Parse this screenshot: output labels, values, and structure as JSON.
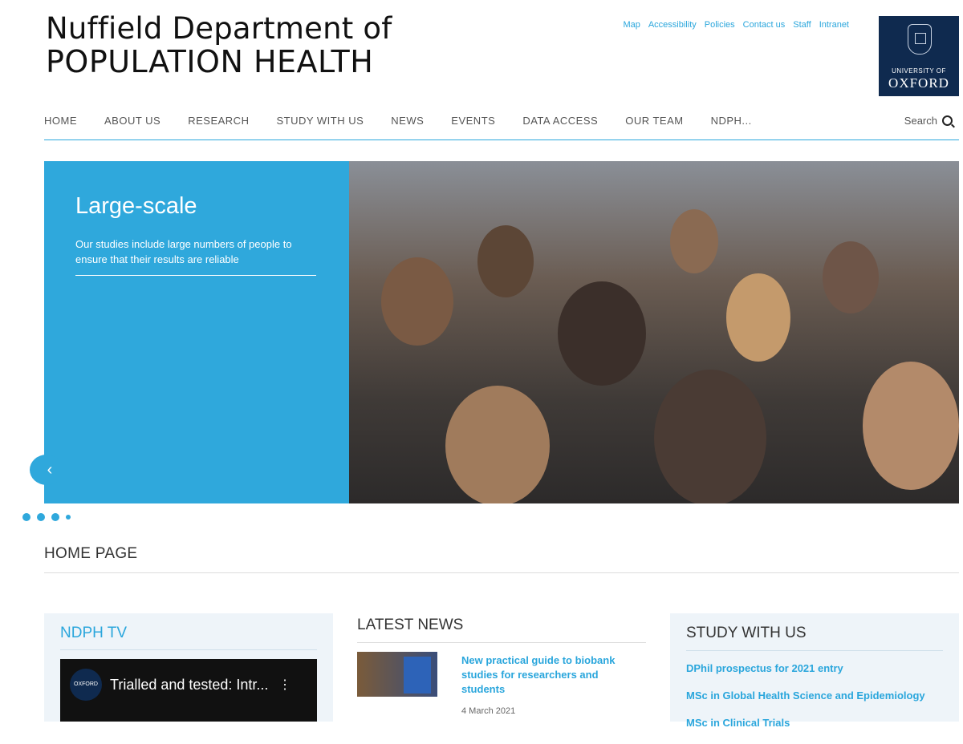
{
  "header": {
    "title_line1": "Nuffield Department of",
    "title_line2": "POPULATION HEALTH",
    "utility_links": [
      "Map",
      "Accessibility",
      "Policies",
      "Contact us",
      "Staff",
      "Intranet"
    ],
    "oxford_logo": {
      "university": "UNIVERSITY OF",
      "name": "OXFORD"
    }
  },
  "nav": {
    "items": [
      "HOME",
      "ABOUT US",
      "RESEARCH",
      "STUDY WITH US",
      "NEWS",
      "EVENTS",
      "DATA ACCESS",
      "OUR TEAM",
      "NDPH..."
    ],
    "search_label": "Search"
  },
  "carousel": {
    "slide_title": "Large-scale",
    "slide_text": "Our studies include large numbers of people to ensure that their results are reliable",
    "prev_icon": "chevron-left-icon",
    "active_dot": 3
  },
  "page": {
    "heading": "HOME PAGE"
  },
  "tv": {
    "heading": "NDPH TV",
    "video_title": "Trialled and tested: Intr...",
    "video_logo": "OXFORD"
  },
  "news": {
    "heading": "LATEST NEWS",
    "item_title": "New practical guide to biobank studies for researchers and students",
    "item_date": "4 March 2021"
  },
  "study": {
    "heading": "STUDY WITH US",
    "items": [
      "DPhil prospectus for 2021 entry",
      "MSc in Global Health Science and Epidemiology",
      "MSc in Clinical Trials"
    ]
  },
  "colors": {
    "accent": "#2fa8dc",
    "oxford_blue": "#0f2a4f"
  }
}
